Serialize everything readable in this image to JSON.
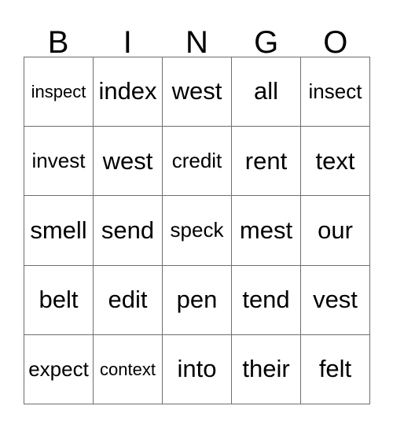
{
  "card": {
    "title": "BINGO",
    "header_letters": [
      "B",
      "I",
      "N",
      "G",
      "O"
    ],
    "colors": {
      "border": "#6e6e6e",
      "text": "#000000",
      "background": "#ffffff"
    },
    "rows": [
      [
        {
          "text": "inspect",
          "size": "sm"
        },
        {
          "text": "index",
          "size": "lg"
        },
        {
          "text": "west",
          "size": "lg"
        },
        {
          "text": "all",
          "size": "lg"
        },
        {
          "text": "insect",
          "size": "md"
        }
      ],
      [
        {
          "text": "invest",
          "size": "md"
        },
        {
          "text": "west",
          "size": "lg"
        },
        {
          "text": "credit",
          "size": "md"
        },
        {
          "text": "rent",
          "size": "lg"
        },
        {
          "text": "text",
          "size": "lg"
        }
      ],
      [
        {
          "text": "smell",
          "size": "lg"
        },
        {
          "text": "send",
          "size": "lg"
        },
        {
          "text": "speck",
          "size": "md"
        },
        {
          "text": "mest",
          "size": "lg"
        },
        {
          "text": "our",
          "size": "lg"
        }
      ],
      [
        {
          "text": "belt",
          "size": "lg"
        },
        {
          "text": "edit",
          "size": "lg"
        },
        {
          "text": "pen",
          "size": "lg"
        },
        {
          "text": "tend",
          "size": "lg"
        },
        {
          "text": "vest",
          "size": "lg"
        }
      ],
      [
        {
          "text": "expect",
          "size": "md"
        },
        {
          "text": "context",
          "size": "sm"
        },
        {
          "text": "into",
          "size": "lg"
        },
        {
          "text": "their",
          "size": "lg"
        },
        {
          "text": "felt",
          "size": "lg"
        }
      ]
    ]
  }
}
